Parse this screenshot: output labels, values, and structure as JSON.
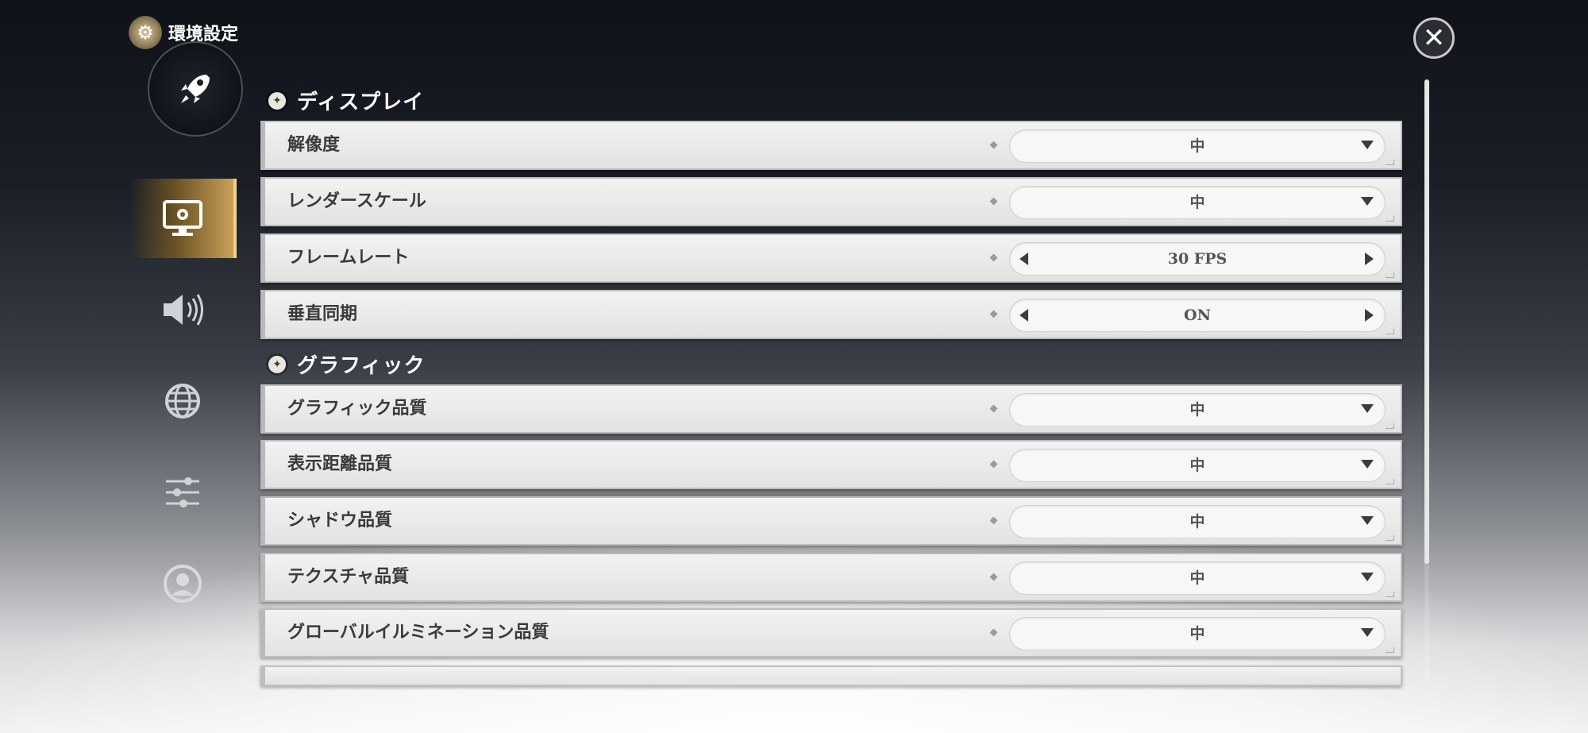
{
  "header": {
    "title": "環境設定",
    "emblem_icon": "gear-emblem-icon",
    "close_icon": "close-icon"
  },
  "nav": {
    "items": [
      {
        "name": "rocket",
        "icon": "rocket-icon",
        "active": false
      },
      {
        "name": "display",
        "icon": "monitor-gear-icon",
        "active": true
      },
      {
        "name": "sound",
        "icon": "speaker-icon",
        "active": false
      },
      {
        "name": "language",
        "icon": "globe-icon",
        "active": false
      },
      {
        "name": "controls",
        "icon": "sliders-icon",
        "active": false
      },
      {
        "name": "account",
        "icon": "user-icon",
        "active": false
      }
    ]
  },
  "sections": {
    "display": {
      "title": "ディスプレイ",
      "rows": [
        {
          "label": "解像度",
          "value": "中",
          "type": "dropdown"
        },
        {
          "label": "レンダースケール",
          "value": "中",
          "type": "dropdown"
        },
        {
          "label": "フレームレート",
          "value": "30 FPS",
          "type": "stepper"
        },
        {
          "label": "垂直同期",
          "value": "ON",
          "type": "stepper"
        }
      ]
    },
    "graphics": {
      "title": "グラフィック",
      "rows": [
        {
          "label": "グラフィック品質",
          "value": "中",
          "type": "dropdown"
        },
        {
          "label": "表示距離品質",
          "value": "中",
          "type": "dropdown"
        },
        {
          "label": "シャドウ品質",
          "value": "中",
          "type": "dropdown"
        },
        {
          "label": "テクスチャ品質",
          "value": "中",
          "type": "dropdown"
        },
        {
          "label": "グローバルイルミネーション品質",
          "value": "中",
          "type": "dropdown"
        }
      ]
    }
  },
  "colors": {
    "accent": "#c9a15a",
    "row_bg": "#ececec",
    "text": "#3a3a3a"
  }
}
